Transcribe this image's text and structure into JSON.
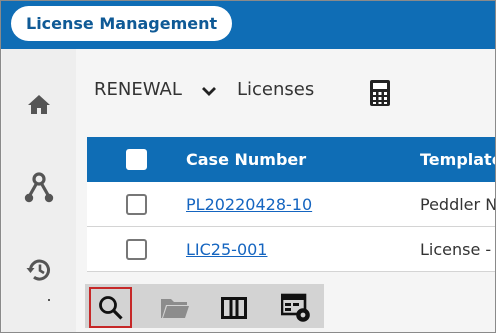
{
  "app": {
    "title": "License Management"
  },
  "sidenav": {
    "items": [
      {
        "icon": "home-icon",
        "label": "Home"
      },
      {
        "icon": "workflow-icon",
        "label": "Workflow"
      },
      {
        "icon": "history-icon",
        "label": "History"
      }
    ]
  },
  "breadcrumb": {
    "category": "RENEWAL",
    "page": "Licenses",
    "calculator_icon": "calculator-icon"
  },
  "grid": {
    "columns": [
      "Case Number",
      "Template"
    ],
    "rows": [
      {
        "case_number": "PL20220428-10",
        "template": "Peddler N"
      },
      {
        "case_number": "LIC25-001",
        "template": "License - F"
      }
    ]
  },
  "toolbar": {
    "tools": [
      "search-icon",
      "folder-icon",
      "columns-icon",
      "grid-settings-icon"
    ],
    "active": "search-icon"
  },
  "colors": {
    "header_blue": "#0f6db5",
    "link_blue": "#1565c0",
    "active_outline": "#c62828"
  }
}
